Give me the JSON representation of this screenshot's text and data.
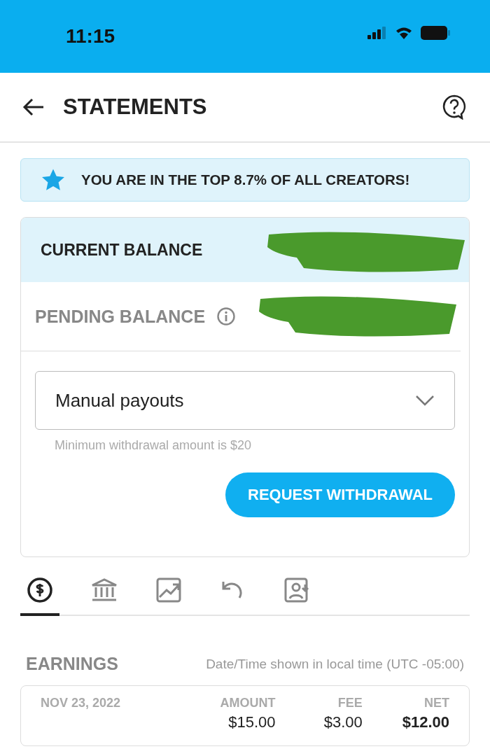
{
  "status_bar": {
    "time": "11:15"
  },
  "header": {
    "title": "STATEMENTS"
  },
  "banner": {
    "text": "YOU ARE IN THE TOP 8.7% OF ALL CREATORS!"
  },
  "balances": [
    {
      "kind": "current",
      "label": "CURRENT BALANCE",
      "value_redacted": true
    },
    {
      "kind": "pending",
      "label": "PENDING BALANCE",
      "value_redacted": true
    }
  ],
  "payout_select": {
    "value": "Manual payouts",
    "hint": "Minimum withdrawal amount is $20"
  },
  "withdraw_button": "REQUEST WITHDRAWAL",
  "tabs": [
    {
      "kind": "earnings",
      "selected": true
    },
    {
      "kind": "bank",
      "selected": false
    },
    {
      "kind": "chart",
      "selected": false
    },
    {
      "kind": "refund",
      "selected": false
    },
    {
      "kind": "referral",
      "selected": false
    }
  ],
  "earnings": {
    "title": "EARNINGS",
    "note": "Date/Time shown in local time (UTC -05:00)",
    "columns": [
      "NOV 23, 2022",
      "AMOUNT",
      "FEE",
      "NET"
    ],
    "rows": [
      [
        "",
        "$15.00",
        "$3.00",
        "$12.00"
      ]
    ]
  }
}
